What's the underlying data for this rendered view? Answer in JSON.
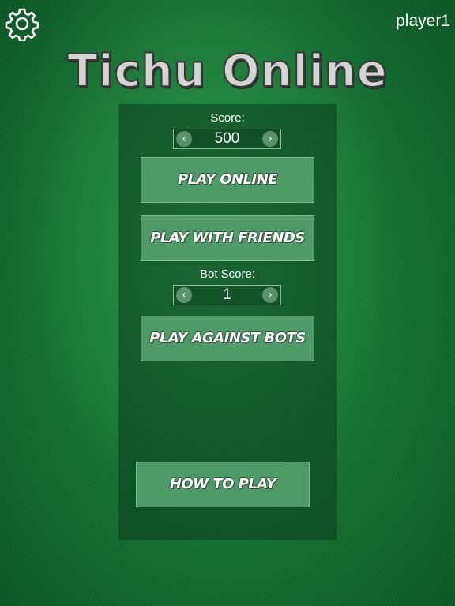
{
  "header": {
    "settings_icon": "gear-icon",
    "username": "player1"
  },
  "title": "Tichu Online",
  "score": {
    "label": "Score:",
    "value": "500",
    "decrease_icon": "chevron-left-icon",
    "increase_icon": "chevron-right-icon"
  },
  "buttons": {
    "play_online": "PLAY ONLINE",
    "play_with_friends": "PLAY WITH FRIENDS",
    "play_against_bots": "PLAY AGAINST BOTS",
    "how_to_play": "HOW TO PLAY"
  },
  "bot_score": {
    "label": "Bot Score:",
    "value": "1",
    "decrease_icon": "chevron-left-icon",
    "increase_icon": "chevron-right-icon"
  },
  "colors": {
    "felt": "#137030",
    "button": "#4f9b67",
    "panel": "#0a3c1c"
  }
}
